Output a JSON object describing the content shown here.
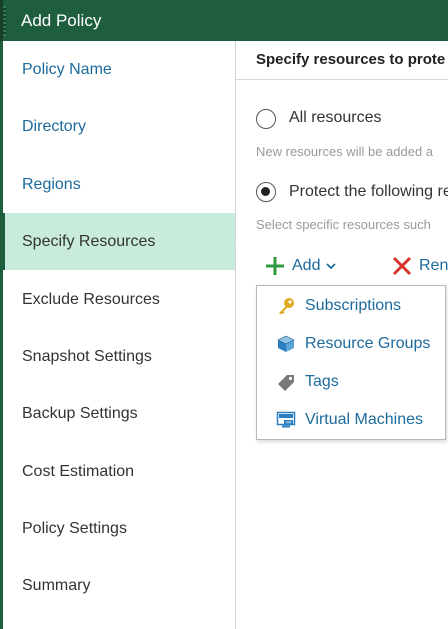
{
  "window": {
    "title": "Add Policy"
  },
  "sidebar": {
    "items": [
      {
        "label": "Policy Name",
        "state": "done"
      },
      {
        "label": "Directory",
        "state": "done"
      },
      {
        "label": "Regions",
        "state": "done"
      },
      {
        "label": "Specify Resources",
        "state": "active"
      },
      {
        "label": "Exclude Resources",
        "state": "todo"
      },
      {
        "label": "Snapshot Settings",
        "state": "todo"
      },
      {
        "label": "Backup Settings",
        "state": "todo"
      },
      {
        "label": "Cost Estimation",
        "state": "todo"
      },
      {
        "label": "Policy Settings",
        "state": "todo"
      },
      {
        "label": "Summary",
        "state": "todo"
      }
    ]
  },
  "main": {
    "heading": "Specify resources to prote",
    "options": [
      {
        "label": "All resources",
        "hint": "New resources will be added a",
        "selected": false
      },
      {
        "label": "Protect the following re",
        "hint": "Select specific resources such",
        "selected": true
      }
    ],
    "toolbar": {
      "add_label": "Add",
      "add_icon": "plus-icon",
      "remove_label": "Ren",
      "remove_icon": "x-icon"
    },
    "add_menu": {
      "items": [
        {
          "label": "Subscriptions",
          "icon": "key-icon"
        },
        {
          "label": "Resource Groups",
          "icon": "cube-icon"
        },
        {
          "label": "Tags",
          "icon": "tag-icon"
        },
        {
          "label": "Virtual Machines",
          "icon": "vm-icon"
        }
      ]
    }
  },
  "colors": {
    "titlebar": "#1e5e3f",
    "active_nav": "#c9ebdb",
    "link": "#1c6b9c",
    "plus": "#2e9a3e",
    "remove": "#d9342b",
    "key": "#e0a81e"
  }
}
